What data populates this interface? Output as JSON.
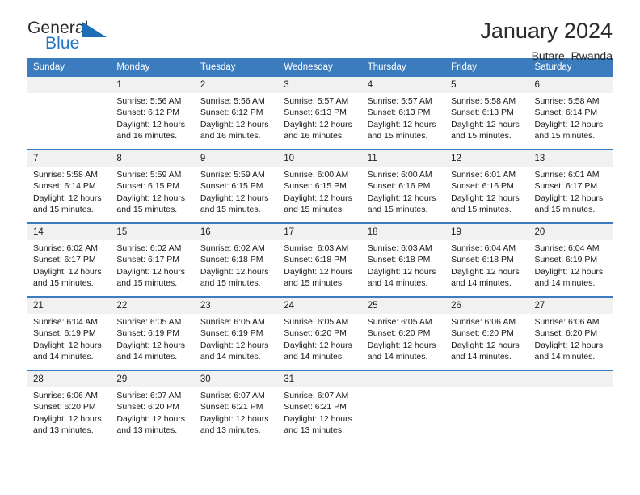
{
  "logo": {
    "word_top": "General",
    "word_bottom": "Blue",
    "triangle_color": "#1f6db5",
    "blue_color": "#2176c7"
  },
  "header": {
    "title": "January 2024",
    "subtitle": "Butare, Rwanda"
  },
  "theme": {
    "header_blue": "#3a7cbe",
    "daynum_band": "#f1f1f1",
    "text": "#1a1a1a"
  },
  "labels": {
    "sunrise_prefix": "Sunrise:",
    "sunset_prefix": "Sunset:",
    "daylight_prefix": "Daylight:"
  },
  "day_headers": [
    "Sunday",
    "Monday",
    "Tuesday",
    "Wednesday",
    "Thursday",
    "Friday",
    "Saturday"
  ],
  "weeks": [
    [
      {
        "day": "",
        "sunrise": "",
        "sunset": "",
        "daylight_line1": "",
        "daylight_line2": ""
      },
      {
        "day": "1",
        "sunrise": "Sunrise: 5:56 AM",
        "sunset": "Sunset: 6:12 PM",
        "daylight_line1": "Daylight: 12 hours",
        "daylight_line2": "and 16 minutes."
      },
      {
        "day": "2",
        "sunrise": "Sunrise: 5:56 AM",
        "sunset": "Sunset: 6:12 PM",
        "daylight_line1": "Daylight: 12 hours",
        "daylight_line2": "and 16 minutes."
      },
      {
        "day": "3",
        "sunrise": "Sunrise: 5:57 AM",
        "sunset": "Sunset: 6:13 PM",
        "daylight_line1": "Daylight: 12 hours",
        "daylight_line2": "and 16 minutes."
      },
      {
        "day": "4",
        "sunrise": "Sunrise: 5:57 AM",
        "sunset": "Sunset: 6:13 PM",
        "daylight_line1": "Daylight: 12 hours",
        "daylight_line2": "and 15 minutes."
      },
      {
        "day": "5",
        "sunrise": "Sunrise: 5:58 AM",
        "sunset": "Sunset: 6:13 PM",
        "daylight_line1": "Daylight: 12 hours",
        "daylight_line2": "and 15 minutes."
      },
      {
        "day": "6",
        "sunrise": "Sunrise: 5:58 AM",
        "sunset": "Sunset: 6:14 PM",
        "daylight_line1": "Daylight: 12 hours",
        "daylight_line2": "and 15 minutes."
      }
    ],
    [
      {
        "day": "7",
        "sunrise": "Sunrise: 5:58 AM",
        "sunset": "Sunset: 6:14 PM",
        "daylight_line1": "Daylight: 12 hours",
        "daylight_line2": "and 15 minutes."
      },
      {
        "day": "8",
        "sunrise": "Sunrise: 5:59 AM",
        "sunset": "Sunset: 6:15 PM",
        "daylight_line1": "Daylight: 12 hours",
        "daylight_line2": "and 15 minutes."
      },
      {
        "day": "9",
        "sunrise": "Sunrise: 5:59 AM",
        "sunset": "Sunset: 6:15 PM",
        "daylight_line1": "Daylight: 12 hours",
        "daylight_line2": "and 15 minutes."
      },
      {
        "day": "10",
        "sunrise": "Sunrise: 6:00 AM",
        "sunset": "Sunset: 6:15 PM",
        "daylight_line1": "Daylight: 12 hours",
        "daylight_line2": "and 15 minutes."
      },
      {
        "day": "11",
        "sunrise": "Sunrise: 6:00 AM",
        "sunset": "Sunset: 6:16 PM",
        "daylight_line1": "Daylight: 12 hours",
        "daylight_line2": "and 15 minutes."
      },
      {
        "day": "12",
        "sunrise": "Sunrise: 6:01 AM",
        "sunset": "Sunset: 6:16 PM",
        "daylight_line1": "Daylight: 12 hours",
        "daylight_line2": "and 15 minutes."
      },
      {
        "day": "13",
        "sunrise": "Sunrise: 6:01 AM",
        "sunset": "Sunset: 6:17 PM",
        "daylight_line1": "Daylight: 12 hours",
        "daylight_line2": "and 15 minutes."
      }
    ],
    [
      {
        "day": "14",
        "sunrise": "Sunrise: 6:02 AM",
        "sunset": "Sunset: 6:17 PM",
        "daylight_line1": "Daylight: 12 hours",
        "daylight_line2": "and 15 minutes."
      },
      {
        "day": "15",
        "sunrise": "Sunrise: 6:02 AM",
        "sunset": "Sunset: 6:17 PM",
        "daylight_line1": "Daylight: 12 hours",
        "daylight_line2": "and 15 minutes."
      },
      {
        "day": "16",
        "sunrise": "Sunrise: 6:02 AM",
        "sunset": "Sunset: 6:18 PM",
        "daylight_line1": "Daylight: 12 hours",
        "daylight_line2": "and 15 minutes."
      },
      {
        "day": "17",
        "sunrise": "Sunrise: 6:03 AM",
        "sunset": "Sunset: 6:18 PM",
        "daylight_line1": "Daylight: 12 hours",
        "daylight_line2": "and 15 minutes."
      },
      {
        "day": "18",
        "sunrise": "Sunrise: 6:03 AM",
        "sunset": "Sunset: 6:18 PM",
        "daylight_line1": "Daylight: 12 hours",
        "daylight_line2": "and 14 minutes."
      },
      {
        "day": "19",
        "sunrise": "Sunrise: 6:04 AM",
        "sunset": "Sunset: 6:18 PM",
        "daylight_line1": "Daylight: 12 hours",
        "daylight_line2": "and 14 minutes."
      },
      {
        "day": "20",
        "sunrise": "Sunrise: 6:04 AM",
        "sunset": "Sunset: 6:19 PM",
        "daylight_line1": "Daylight: 12 hours",
        "daylight_line2": "and 14 minutes."
      }
    ],
    [
      {
        "day": "21",
        "sunrise": "Sunrise: 6:04 AM",
        "sunset": "Sunset: 6:19 PM",
        "daylight_line1": "Daylight: 12 hours",
        "daylight_line2": "and 14 minutes."
      },
      {
        "day": "22",
        "sunrise": "Sunrise: 6:05 AM",
        "sunset": "Sunset: 6:19 PM",
        "daylight_line1": "Daylight: 12 hours",
        "daylight_line2": "and 14 minutes."
      },
      {
        "day": "23",
        "sunrise": "Sunrise: 6:05 AM",
        "sunset": "Sunset: 6:19 PM",
        "daylight_line1": "Daylight: 12 hours",
        "daylight_line2": "and 14 minutes."
      },
      {
        "day": "24",
        "sunrise": "Sunrise: 6:05 AM",
        "sunset": "Sunset: 6:20 PM",
        "daylight_line1": "Daylight: 12 hours",
        "daylight_line2": "and 14 minutes."
      },
      {
        "day": "25",
        "sunrise": "Sunrise: 6:05 AM",
        "sunset": "Sunset: 6:20 PM",
        "daylight_line1": "Daylight: 12 hours",
        "daylight_line2": "and 14 minutes."
      },
      {
        "day": "26",
        "sunrise": "Sunrise: 6:06 AM",
        "sunset": "Sunset: 6:20 PM",
        "daylight_line1": "Daylight: 12 hours",
        "daylight_line2": "and 14 minutes."
      },
      {
        "day": "27",
        "sunrise": "Sunrise: 6:06 AM",
        "sunset": "Sunset: 6:20 PM",
        "daylight_line1": "Daylight: 12 hours",
        "daylight_line2": "and 14 minutes."
      }
    ],
    [
      {
        "day": "28",
        "sunrise": "Sunrise: 6:06 AM",
        "sunset": "Sunset: 6:20 PM",
        "daylight_line1": "Daylight: 12 hours",
        "daylight_line2": "and 13 minutes."
      },
      {
        "day": "29",
        "sunrise": "Sunrise: 6:07 AM",
        "sunset": "Sunset: 6:20 PM",
        "daylight_line1": "Daylight: 12 hours",
        "daylight_line2": "and 13 minutes."
      },
      {
        "day": "30",
        "sunrise": "Sunrise: 6:07 AM",
        "sunset": "Sunset: 6:21 PM",
        "daylight_line1": "Daylight: 12 hours",
        "daylight_line2": "and 13 minutes."
      },
      {
        "day": "31",
        "sunrise": "Sunrise: 6:07 AM",
        "sunset": "Sunset: 6:21 PM",
        "daylight_line1": "Daylight: 12 hours",
        "daylight_line2": "and 13 minutes."
      },
      {
        "day": "",
        "sunrise": "",
        "sunset": "",
        "daylight_line1": "",
        "daylight_line2": ""
      },
      {
        "day": "",
        "sunrise": "",
        "sunset": "",
        "daylight_line1": "",
        "daylight_line2": ""
      },
      {
        "day": "",
        "sunrise": "",
        "sunset": "",
        "daylight_line1": "",
        "daylight_line2": ""
      }
    ]
  ]
}
